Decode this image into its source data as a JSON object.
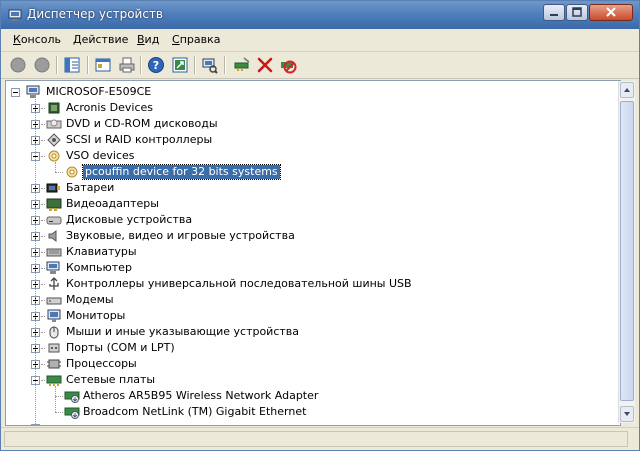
{
  "window": {
    "title": "Диспетчер устройств",
    "title_icon": "device-manager-icon"
  },
  "menu": {
    "items": [
      {
        "label": "Консоль",
        "underline": "К",
        "rest": "онсоль"
      },
      {
        "label": "Действие",
        "underline": "Д",
        "rest": "ействие"
      },
      {
        "label": "Вид",
        "underline": "В",
        "rest": "ид"
      },
      {
        "label": "Справка",
        "underline": "С",
        "rest": "правка"
      }
    ]
  },
  "toolbar": {
    "buttons": [
      "back-icon",
      "forward-icon",
      "show-hide-tree-icon",
      "properties-icon",
      "print-icon",
      "help-icon",
      "export-list-icon",
      "scan-hardware-icon",
      "update-driver-icon",
      "uninstall-icon",
      "disable-icon"
    ]
  },
  "tree": {
    "root": "MICROSOF-E509CE",
    "categories": [
      {
        "label": "Acronis Devices",
        "expanded": false
      },
      {
        "label": "DVD и CD-ROM дисководы",
        "expanded": false
      },
      {
        "label": "SCSI и RAID контроллеры",
        "expanded": false
      },
      {
        "label": "VSO devices",
        "expanded": true,
        "children": [
          "pcouffin device for 32 bits systems"
        ]
      },
      {
        "label": "Батареи",
        "expanded": false
      },
      {
        "label": "Видеоадаптеры",
        "expanded": false
      },
      {
        "label": "Дисковые устройства",
        "expanded": false
      },
      {
        "label": "Звуковые, видео и игровые устройства",
        "expanded": false
      },
      {
        "label": "Клавиатуры",
        "expanded": false
      },
      {
        "label": "Компьютер",
        "expanded": false
      },
      {
        "label": "Контроллеры универсальной последовательной шины USB",
        "expanded": false
      },
      {
        "label": "Модемы",
        "expanded": false
      },
      {
        "label": "Мониторы",
        "expanded": false
      },
      {
        "label": "Мыши и иные указывающие устройства",
        "expanded": false
      },
      {
        "label": "Порты (COM и LPT)",
        "expanded": false
      },
      {
        "label": "Процессоры",
        "expanded": false
      },
      {
        "label": "Сетевые платы",
        "expanded": true,
        "children": [
          "Atheros AR5B95 Wireless Network Adapter",
          "Broadcom NetLink (TM) Gigabit Ethernet"
        ]
      }
    ],
    "selected": "pcouffin device for 32 bits systems"
  }
}
